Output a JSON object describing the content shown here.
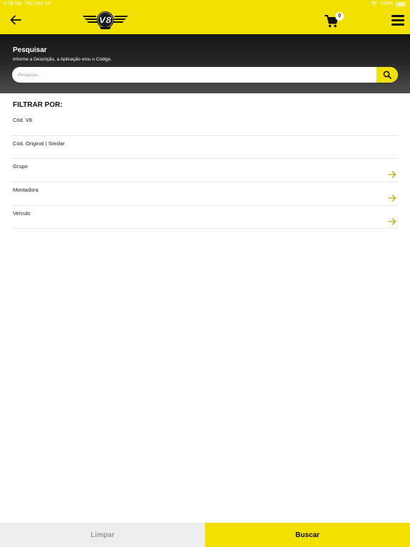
{
  "status_bar": {
    "time": "9:38 AM",
    "date": "Thu Dec 10",
    "battery": "100%"
  },
  "header": {
    "back_icon": "arrow-left-icon",
    "logo_text": "V8",
    "cart_count": "0",
    "cart_icon": "shopping-cart-icon",
    "menu_icon": "hamburger-menu-icon"
  },
  "search": {
    "title": "Pesquisar",
    "subtitle": "Informe a Descrição, a Aplicação e/ou o Código.",
    "placeholder": "Pesquisa...",
    "button_icon": "search-icon"
  },
  "filters": {
    "title": "FILTRAR POR:",
    "items": [
      {
        "label": "Cód. V8",
        "has_arrow": false
      },
      {
        "label": "Cód. Original | Similar",
        "has_arrow": false
      },
      {
        "label": "Grupo",
        "has_arrow": true
      },
      {
        "label": "Montadora",
        "has_arrow": true
      },
      {
        "label": "Veículo",
        "has_arrow": true
      }
    ]
  },
  "actions": {
    "clear_label": "Limpar",
    "search_label": "Buscar"
  },
  "colors": {
    "brand_yellow": "#f2e000",
    "dark_header": "#1f1f1f",
    "arrow_color": "#b9a900",
    "clear_bg": "#eeeeee"
  }
}
